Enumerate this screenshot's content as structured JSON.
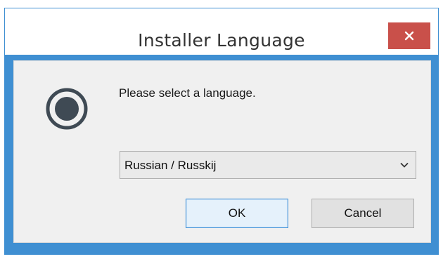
{
  "window": {
    "title": "Installer Language",
    "close_icon": "close-icon"
  },
  "dialog": {
    "icon": "installer-icon",
    "prompt": "Please select a language.",
    "language_select": {
      "selected": "Russian / Russkij",
      "icon": "chevron-down-icon"
    },
    "buttons": {
      "ok": "OK",
      "cancel": "Cancel"
    }
  },
  "colors": {
    "window_border": "#3f8fd2",
    "close_button": "#c9504a",
    "panel_background": "#f0f0f0",
    "default_button_border": "#3c8fd8"
  }
}
